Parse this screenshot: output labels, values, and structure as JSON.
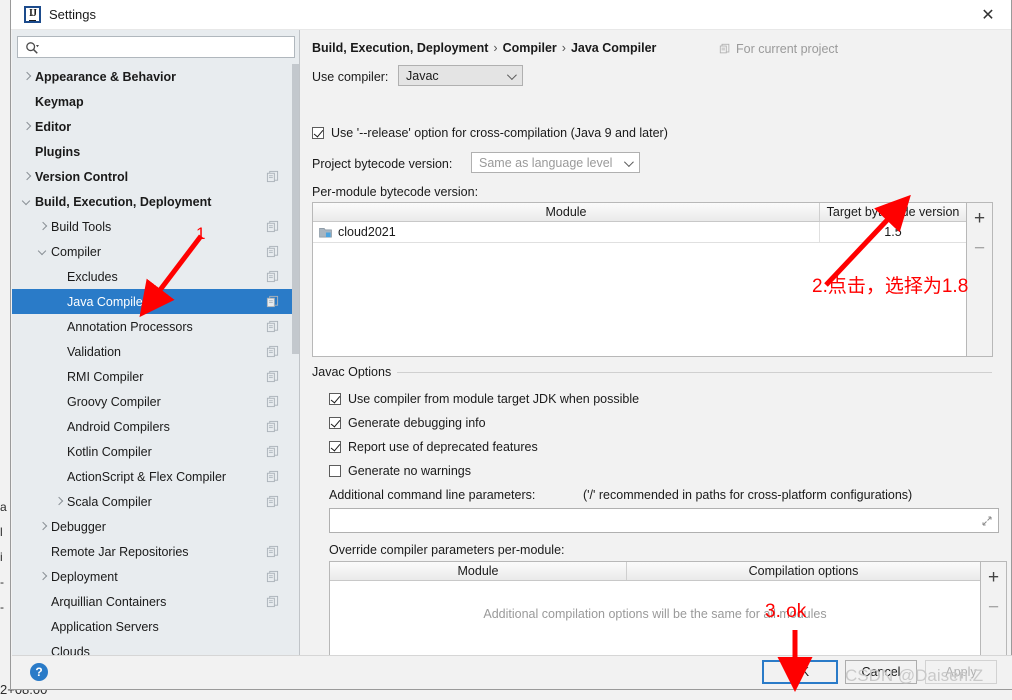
{
  "window": {
    "title": "Settings",
    "app_icon": "intellij-idea-icon",
    "close_label": "✕"
  },
  "background_ide": {
    "left_edge_fragments": [
      "a",
      "l",
      "i",
      "-",
      "-"
    ],
    "bottom_fragment": "2+08:00"
  },
  "sidebar": {
    "search": {
      "value": "",
      "placeholder": ""
    },
    "items": [
      {
        "label": "Appearance & Behavior",
        "indent": 0,
        "bold": true,
        "arrow": "right",
        "copy": false,
        "selected": false
      },
      {
        "label": "Keymap",
        "indent": 0,
        "bold": true,
        "arrow": "none",
        "copy": false,
        "selected": false
      },
      {
        "label": "Editor",
        "indent": 0,
        "bold": true,
        "arrow": "right",
        "copy": false,
        "selected": false
      },
      {
        "label": "Plugins",
        "indent": 0,
        "bold": true,
        "arrow": "none",
        "copy": false,
        "selected": false
      },
      {
        "label": "Version Control",
        "indent": 0,
        "bold": true,
        "arrow": "right",
        "copy": true,
        "selected": false
      },
      {
        "label": "Build, Execution, Deployment",
        "indent": 0,
        "bold": true,
        "arrow": "down",
        "copy": false,
        "selected": false
      },
      {
        "label": "Build Tools",
        "indent": 1,
        "bold": false,
        "arrow": "right",
        "copy": true,
        "selected": false
      },
      {
        "label": "Compiler",
        "indent": 1,
        "bold": false,
        "arrow": "down",
        "copy": true,
        "selected": false
      },
      {
        "label": "Excludes",
        "indent": 2,
        "bold": false,
        "arrow": "none",
        "copy": true,
        "selected": false
      },
      {
        "label": "Java Compiler",
        "indent": 2,
        "bold": false,
        "arrow": "none",
        "copy": true,
        "selected": true
      },
      {
        "label": "Annotation Processors",
        "indent": 2,
        "bold": false,
        "arrow": "none",
        "copy": true,
        "selected": false
      },
      {
        "label": "Validation",
        "indent": 2,
        "bold": false,
        "arrow": "none",
        "copy": true,
        "selected": false
      },
      {
        "label": "RMI Compiler",
        "indent": 2,
        "bold": false,
        "arrow": "none",
        "copy": true,
        "selected": false
      },
      {
        "label": "Groovy Compiler",
        "indent": 2,
        "bold": false,
        "arrow": "none",
        "copy": true,
        "selected": false
      },
      {
        "label": "Android Compilers",
        "indent": 2,
        "bold": false,
        "arrow": "none",
        "copy": true,
        "selected": false
      },
      {
        "label": "Kotlin Compiler",
        "indent": 2,
        "bold": false,
        "arrow": "none",
        "copy": true,
        "selected": false
      },
      {
        "label": "ActionScript & Flex Compiler",
        "indent": 2,
        "bold": false,
        "arrow": "none",
        "copy": true,
        "selected": false
      },
      {
        "label": "Scala Compiler",
        "indent": 2,
        "bold": false,
        "arrow": "right",
        "copy": true,
        "selected": false
      },
      {
        "label": "Debugger",
        "indent": 1,
        "bold": false,
        "arrow": "right",
        "copy": false,
        "selected": false
      },
      {
        "label": "Remote Jar Repositories",
        "indent": 1,
        "bold": false,
        "arrow": "none",
        "copy": true,
        "selected": false
      },
      {
        "label": "Deployment",
        "indent": 1,
        "bold": false,
        "arrow": "right",
        "copy": true,
        "selected": false
      },
      {
        "label": "Arquillian Containers",
        "indent": 1,
        "bold": false,
        "arrow": "none",
        "copy": true,
        "selected": false
      },
      {
        "label": "Application Servers",
        "indent": 1,
        "bold": false,
        "arrow": "none",
        "copy": false,
        "selected": false
      },
      {
        "label": "Clouds",
        "indent": 1,
        "bold": false,
        "arrow": "none",
        "copy": false,
        "selected": false
      }
    ]
  },
  "main": {
    "breadcrumb": {
      "part1": "Build, Execution, Deployment",
      "part2": "Compiler",
      "part3": "Java Compiler",
      "separator": "›"
    },
    "scope_note": "For current project",
    "use_compiler_label": "Use compiler:",
    "use_compiler_value": "Javac",
    "release_option": {
      "label": "Use '--release' option for cross-compilation (Java 9 and later)",
      "checked": true
    },
    "project_bytecode_label": "Project bytecode version:",
    "project_bytecode_value": "Same as language level",
    "per_module_label": "Per-module bytecode version:",
    "module_table": {
      "columns": [
        "Module",
        "Target bytecode version"
      ],
      "rows": [
        {
          "module": "cloud2021",
          "target": "1.5"
        }
      ],
      "add_label": "+",
      "remove_label": "−"
    },
    "javac_group": "Javac Options",
    "javac_options": [
      {
        "label": "Use compiler from module target JDK when possible",
        "checked": true
      },
      {
        "label": "Generate debugging info",
        "checked": true
      },
      {
        "label": "Report use of deprecated features",
        "checked": true
      },
      {
        "label": "Generate no warnings",
        "checked": false
      }
    ],
    "additional_params_label": "Additional command line parameters:",
    "additional_params_hint": "('/' recommended in paths for cross-platform configurations)",
    "additional_params_value": "",
    "override_label": "Override compiler parameters per-module:",
    "override_table": {
      "columns": [
        "Module",
        "Compilation options"
      ],
      "empty_message": "Additional compilation options will be the same for all modules",
      "add_label": "+",
      "remove_label": "−"
    }
  },
  "footer": {
    "help_label": "?",
    "ok_label": "OK",
    "cancel_label": "Cancel",
    "apply_label": "Apply"
  },
  "annotations": {
    "color": "#ff0000",
    "marker1": "1",
    "marker2": "2.点击，选择为1.8",
    "marker3": "3. ok"
  },
  "watermark": "CSDN @Daisen.Z"
}
